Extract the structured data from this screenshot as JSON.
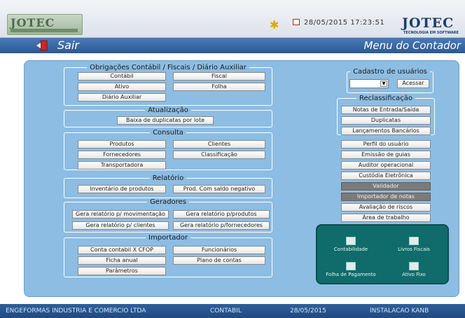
{
  "header": {
    "logo_left": "JOTEC",
    "date_time": "28/05/2015  17:23:51",
    "logo_right": "JOTEC",
    "logo_right_sub": "TECNOLOGIA EM SOFTWARE",
    "exit_label": "Sair",
    "menu_title": "Menu do Contador"
  },
  "obrigacoes": {
    "legend": "Obrigações Contábil / Fiscais / Diário Auxiliar",
    "buttons": [
      "Contábil",
      "Fiscal",
      "Ativo",
      "Folha",
      "Diário Auxiliar"
    ]
  },
  "atualizacao": {
    "legend": "Atualização",
    "buttons": [
      "Baixa de duplicatas por lote"
    ]
  },
  "consulta": {
    "legend": "Consulta",
    "buttons": [
      "Produtos",
      "Clientes",
      "Fornecedores",
      "Classificação",
      "Transportadora"
    ]
  },
  "relatorio": {
    "legend": "Relatório",
    "buttons": [
      "Inventário de produtos",
      "Prod. Com saldo negativo"
    ]
  },
  "geradores": {
    "legend": "Geradores",
    "buttons": [
      "Gera relatório p/ movimentação",
      "Gera relatório p/produtos",
      "Gera relatório p/ clientes",
      "Gera relatório p/fornecedores"
    ]
  },
  "importador": {
    "legend": "Importador",
    "buttons": [
      "Conta contabil X CFOP",
      "Funcionários",
      "Ficha anual",
      "Plano de contas",
      "Parâmetros"
    ]
  },
  "cadastro": {
    "legend": "Cadastro de usuários",
    "select_value": "",
    "access_button": "Acessar"
  },
  "reclassificacao": {
    "legend": "Reclassificação",
    "buttons": [
      "Notas de Entrada/Saída",
      "Duplicatas",
      "Lançamentos Bancários"
    ]
  },
  "right_buttons": [
    {
      "label": "Perfil do usuário",
      "disabled": false
    },
    {
      "label": "Emissão de guias",
      "disabled": false
    },
    {
      "label": "Auditor operacional",
      "disabled": false
    },
    {
      "label": "Custódia Eletrônica",
      "disabled": false
    },
    {
      "label": "Validador",
      "disabled": true
    },
    {
      "label": "Importador de notas",
      "disabled": true
    },
    {
      "label": "Avaliação de riscos",
      "disabled": false
    },
    {
      "label": "Área de trabalho",
      "disabled": false
    }
  ],
  "quick_access": [
    {
      "label": "Contabilidade",
      "icon": "ledger-icon"
    },
    {
      "label": "Livros Fiscais",
      "icon": "books-icon"
    },
    {
      "label": "Folha de Pagamento",
      "icon": "payroll-icon"
    },
    {
      "label": "Ativo Fixo",
      "icon": "asset-icon"
    }
  ],
  "footer": {
    "company": "ENGEFORMAS INDUSTRIA E COMERCIO LTDA",
    "module": "CONTABIL",
    "date": "28/05/2015",
    "installation": "INSTALACAO KANB"
  }
}
